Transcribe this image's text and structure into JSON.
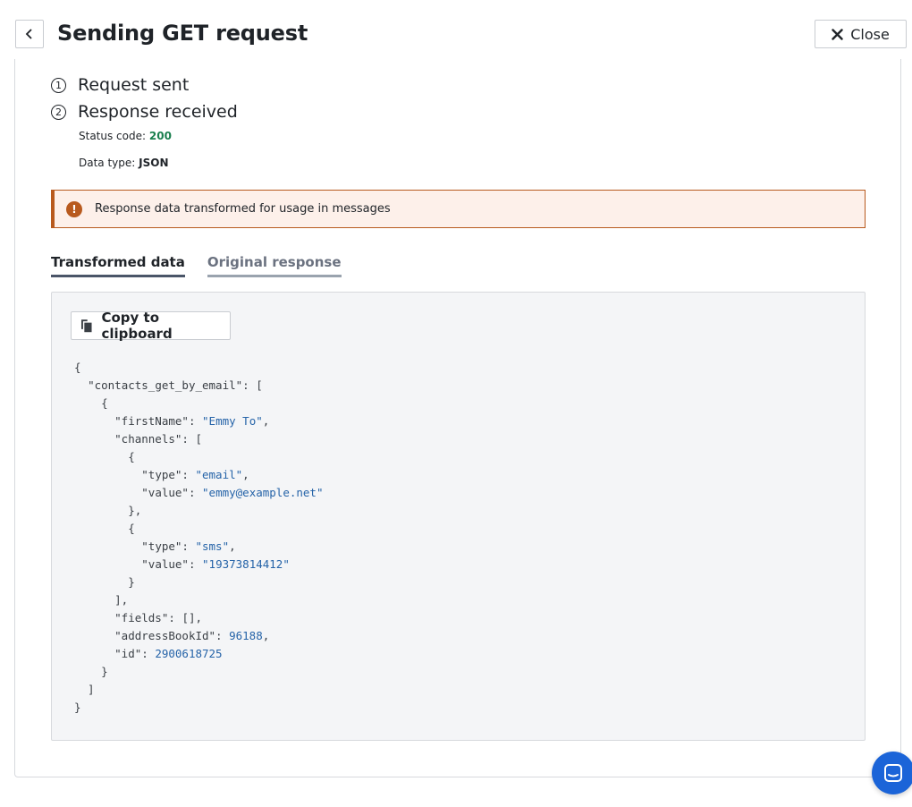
{
  "header": {
    "title": "Sending GET request",
    "close_label": "Close"
  },
  "steps": [
    {
      "num": "1",
      "label": "Request sent"
    },
    {
      "num": "2",
      "label": "Response received"
    }
  ],
  "meta": {
    "status_label": "Status code:",
    "status_value": "200",
    "type_label": "Data type:",
    "type_value": "JSON"
  },
  "alert": {
    "text": "Response data transformed for usage in messages",
    "icon": "!"
  },
  "tabs": [
    {
      "label": "Transformed data",
      "active": true
    },
    {
      "label": "Original response",
      "active": false
    }
  ],
  "code": {
    "copy_label": "Copy to clipboard",
    "lines": [
      "{",
      "  \"contacts_get_by_email\": [",
      "    {",
      "      \"firstName\": \"Emmy To\",",
      "      \"channels\": [",
      "        {",
      "          \"type\": \"email\",",
      "          \"value\": \"emmy@example.net\"",
      "        },",
      "        {",
      "          \"type\": \"sms\",",
      "          \"value\": \"19373814412\"",
      "        }",
      "      ],",
      "      \"fields\": [],",
      "      \"addressBookId\": 96188,",
      "      \"id\": 2900618725",
      "    }",
      "  ]",
      "}"
    ]
  },
  "colors": {
    "status_ok": "#1a7f4e",
    "alert_accent": "#b85a1e",
    "chat_blue": "#1b64d8"
  }
}
